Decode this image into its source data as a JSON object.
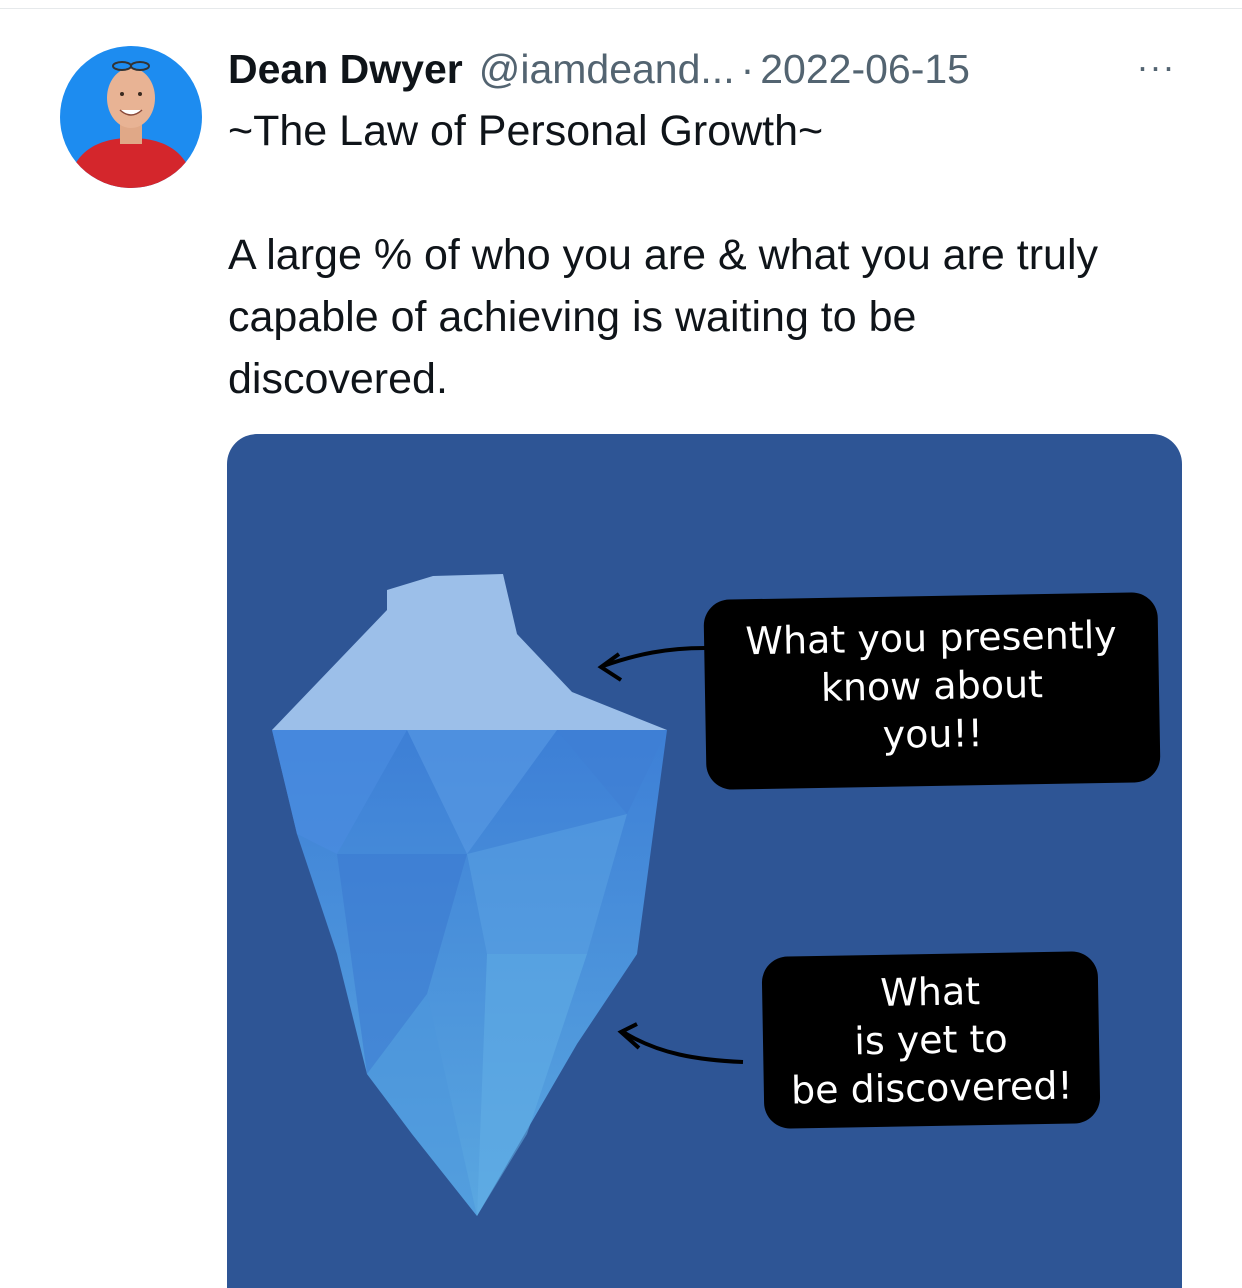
{
  "tweet": {
    "author_name": "Dean Dwyer",
    "author_handle": "@iamdeand...",
    "separator": "·",
    "date": "2022-06-15",
    "more_label": "···",
    "title": "~The Law of Personal Growth~",
    "body": "A large % of who you are & what you are truly capable of achieving is waiting to be discovered."
  },
  "image": {
    "callout_top": "What you presently\nknow about\nyou!!",
    "callout_bottom": "What\nis yet to\nbe discovered!"
  },
  "colors": {
    "text_primary": "#0f1419",
    "text_secondary": "#536471",
    "image_background": "#2e5595",
    "avatar_background": "#1d8cf0"
  }
}
